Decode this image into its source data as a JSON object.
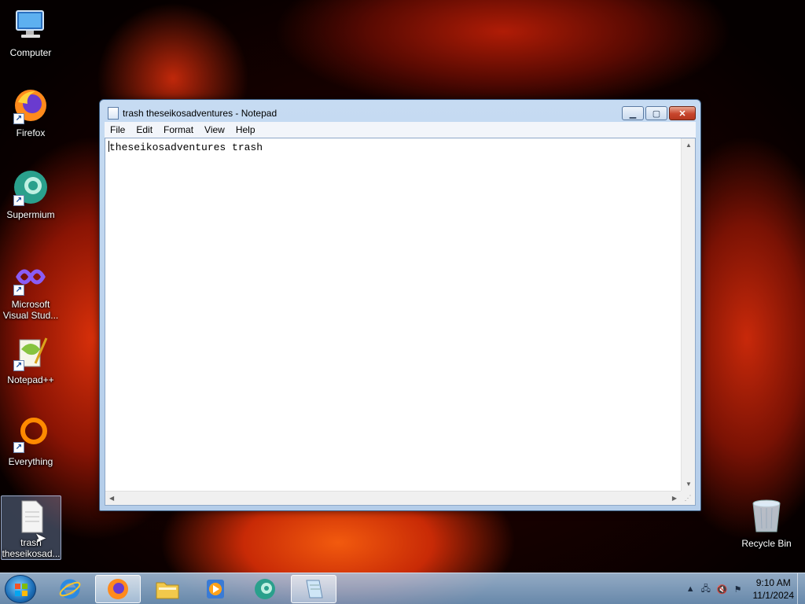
{
  "desktop_icons": [
    {
      "label": "Computer",
      "icon": "computer-icon"
    },
    {
      "label": "Firefox",
      "icon": "firefox-icon"
    },
    {
      "label": "Supermium",
      "icon": "supermium-icon"
    },
    {
      "label": "Microsoft Visual Stud...",
      "icon": "visual-studio-icon"
    },
    {
      "label": "Notepad++",
      "icon": "notepadpp-icon"
    },
    {
      "label": "Everything",
      "icon": "everything-icon"
    },
    {
      "label": "trash theseikosad...",
      "icon": "text-file-icon"
    }
  ],
  "recycle_bin": {
    "label": "Recycle Bin"
  },
  "notepad": {
    "title": "trash theseikosadventures - Notepad",
    "menu": [
      "File",
      "Edit",
      "Format",
      "View",
      "Help"
    ],
    "content": "theseikosadventures trash"
  },
  "taskbar": {
    "apps": [
      "Firefox",
      "Windows Explorer",
      "Windows Media Player",
      "Supermium",
      "Notepad"
    ],
    "active_app": "Notepad",
    "time": "9:10 AM",
    "date": "11/1/2024"
  },
  "colors": {
    "window_frame": "#b4cde9",
    "close_button": "#c7452c",
    "taskbar": "#8fb4d8"
  }
}
